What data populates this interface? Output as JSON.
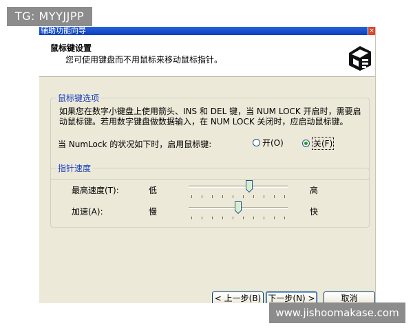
{
  "overlays": {
    "tg": "TG: MYYJJPP",
    "site": "www.jishoomakase.com"
  },
  "window": {
    "title": "辅助功能向导",
    "close_glyph": "×",
    "header_title": "鼠标键设置",
    "header_desc": "您可使用键盘而不用鼠标来移动鼠标指针。"
  },
  "mouse_keys_group": {
    "legend": "鼠标键选项",
    "description_line1": "如果您在数字小键盘上使用箭头、INS 和 DEL 键，当 NUM LOCK 开启时，需要启",
    "description_line2": "动鼠标键。若用数字键盘做数据输入，在 NUM LOCK 关闭时，应启动鼠标键。",
    "numlock_label": "当 NumLock 的状况如下时，启用鼠标键:",
    "radio_on_label": "开(O)",
    "radio_off_label": "关(F)",
    "selected": "off"
  },
  "pointer_speed_group": {
    "legend": "指针速度",
    "top_speed_label": "最高速度(T):",
    "top_speed_low": "低",
    "top_speed_high": "高",
    "top_speed_value": 0.62,
    "accel_label": "加速(A):",
    "accel_low": "慢",
    "accel_high": "快",
    "accel_value": 0.5
  },
  "buttons": {
    "back": "< 上一步(B)",
    "next": "下一步(N) >",
    "cancel": "取消"
  },
  "colors": {
    "dialog_bg": "#ECE9D8",
    "legend_blue": "#1a40c0",
    "titlebar_blue": "#0b3fbf"
  }
}
